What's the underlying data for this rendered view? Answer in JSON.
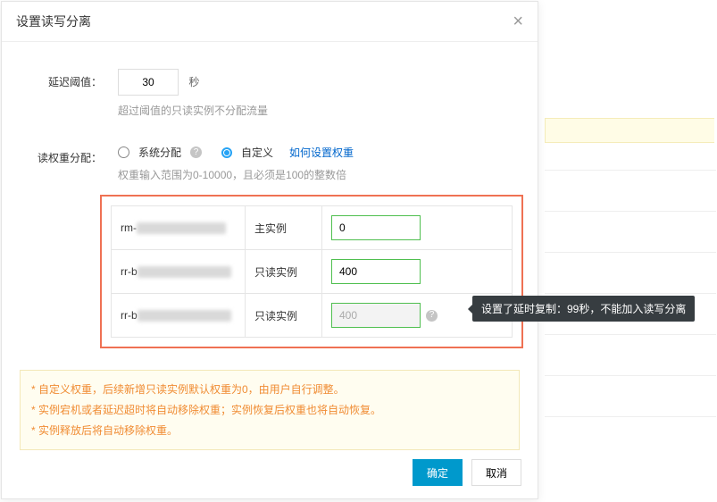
{
  "modal": {
    "title": "设置读写分离",
    "threshold": {
      "label": "延迟阈值：",
      "value": "30",
      "unit": "秒",
      "help": "超过阈值的只读实例不分配流量"
    },
    "weight": {
      "label": "读权重分配：",
      "system": "系统分配",
      "custom": "自定义",
      "link": "如何设置权重",
      "help": "权重输入范围为0-10000，且必须是100的整数倍"
    },
    "rows": [
      {
        "prefix": "rm-",
        "type": "主实例",
        "value": "0",
        "disabled": false
      },
      {
        "prefix": "rr-b",
        "type": "只读实例",
        "value": "400",
        "disabled": false
      },
      {
        "prefix": "rr-b",
        "type": "只读实例",
        "value": "400",
        "disabled": true
      }
    ],
    "tooltip": "设置了延时复制：99秒，不能加入读写分离",
    "notes": [
      "* 自定义权重，后续新增只读实例默认权重为0，由用户自行调整。",
      "* 实例宕机或者延迟超时将自动移除权重；实例恢复后权重也将自动恢复。",
      "* 实例释放后将自动移除权重。"
    ],
    "buttons": {
      "ok": "确定",
      "cancel": "取消"
    }
  }
}
